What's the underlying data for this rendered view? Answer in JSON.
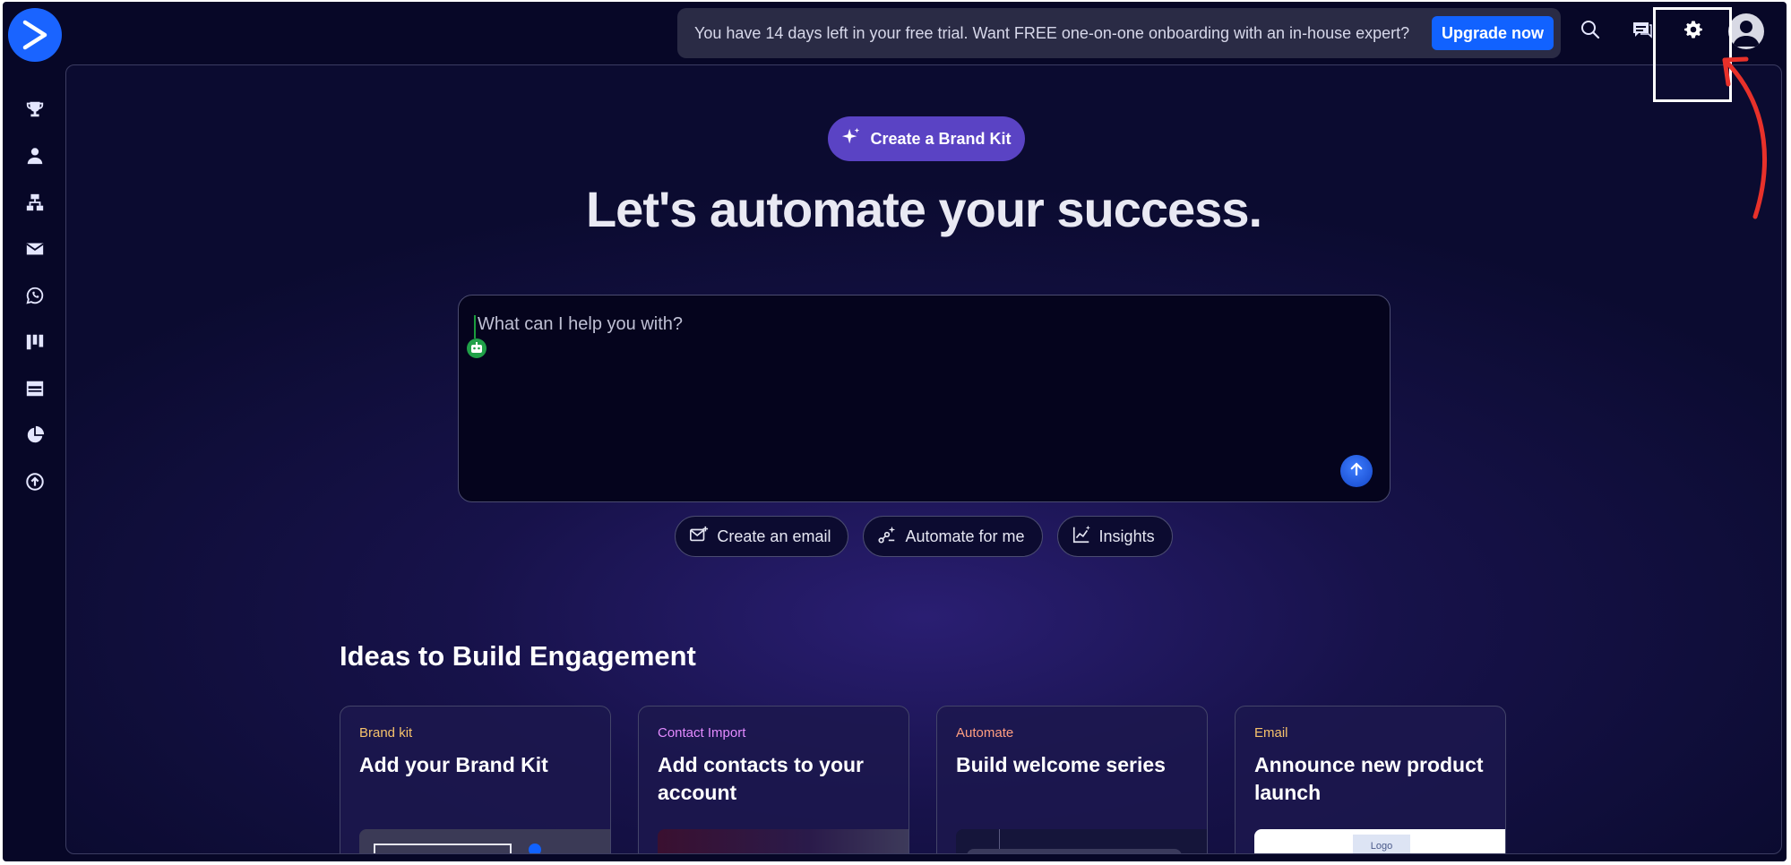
{
  "topbar": {
    "trial_message": "You have 14 days left in your free trial. Want FREE one-on-one onboarding with an in-house expert?",
    "upgrade_label": "Upgrade now"
  },
  "sidebar": {
    "items": [
      {
        "icon": "trophy-icon"
      },
      {
        "icon": "person-icon"
      },
      {
        "icon": "sitemap-icon"
      },
      {
        "icon": "envelope-icon"
      },
      {
        "icon": "whatsapp-icon"
      },
      {
        "icon": "kanban-icon"
      },
      {
        "icon": "browser-window-icon"
      },
      {
        "icon": "pie-chart-icon"
      },
      {
        "icon": "upload-circle-icon"
      }
    ]
  },
  "main": {
    "brand_kit_button": "Create a Brand Kit",
    "headline": "Let's automate your success.",
    "prompt_placeholder": "What can I help you with?",
    "chips": [
      {
        "label": "Create an email"
      },
      {
        "label": "Automate for me"
      },
      {
        "label": "Insights"
      }
    ],
    "ideas_title": "Ideas to Build Engagement",
    "cards": [
      {
        "category": "Brand kit",
        "title": "Add your Brand Kit",
        "category_color": "#f6c26b"
      },
      {
        "category": "Contact Import",
        "title": "Add contacts to your account",
        "category_color": "#e38bff"
      },
      {
        "category": "Automate",
        "title": "Build welcome series",
        "category_color": "#ff9e80"
      },
      {
        "category": "Email",
        "title": "Announce new product launch",
        "category_color": "#f6c26b"
      }
    ],
    "email_preview_logo": "Logo"
  },
  "colors": {
    "accent_blue": "#1162ff",
    "brand_kit_purple": "#5a43c4",
    "annotation_red": "#e8312a"
  }
}
